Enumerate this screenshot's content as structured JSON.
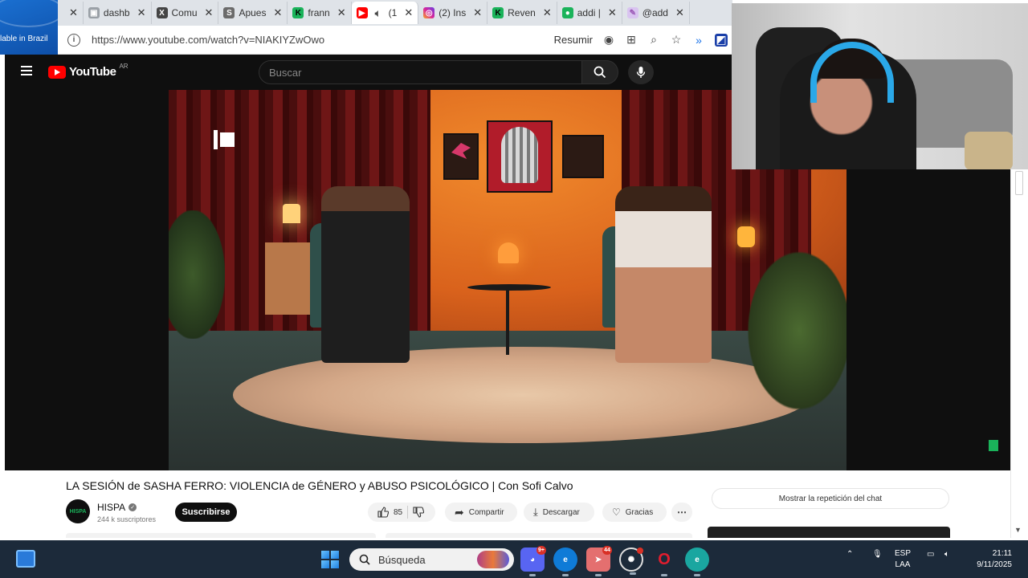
{
  "other_window": {
    "text": "lable in Brazil"
  },
  "browser": {
    "tabs": [
      {
        "label": "",
        "icon": "close-icon"
      },
      {
        "label": "dashb",
        "icon": "page-icon",
        "color": "#5f6368"
      },
      {
        "label": "Comu",
        "icon": "x-icon",
        "color": "#444444"
      },
      {
        "label": "Apues",
        "icon": "s-icon",
        "color": "#6b6b6b"
      },
      {
        "label": "frann",
        "icon": "kick-icon",
        "color": "#1ab35a"
      },
      {
        "label": "(1",
        "icon": "youtube-icon",
        "color": "#ff0000",
        "active": true
      },
      {
        "label": "(2) Ins",
        "icon": "instagram-icon",
        "color": "#d6249f"
      },
      {
        "label": "Reven",
        "icon": "kick-icon",
        "color": "#1ab35a"
      },
      {
        "label": "addi |",
        "icon": "pin-icon",
        "color": "#1ab35a"
      },
      {
        "label": "@add",
        "icon": "feather-icon",
        "color": "#9b59b6"
      }
    ],
    "url": "https://www.youtube.com/watch?v=NIAKIYZwOwo",
    "resumir_label": "Resumir"
  },
  "youtube": {
    "logo_text": "YouTube",
    "region": "AR",
    "search_placeholder": "Buscar"
  },
  "video": {
    "title": "LA SESIÓN de SASHA FERRO: VIOLENCIA de GÉNERO y ABUSO PSICOLÓGICO | Con Sofi Calvo",
    "channel": "HISPA",
    "avatar_text": "HISPA",
    "subscribers": "244 k suscriptores",
    "subscribe_label": "Suscribirse",
    "likes": "85",
    "share_label": "Compartir",
    "download_label": "Descargar",
    "thanks_label": "Gracias",
    "chat_replay_label": "Mostrar la repetición del chat"
  },
  "taskbar": {
    "search_label": "Búsqueda",
    "apps": [
      {
        "name": "discord",
        "badge": "9+",
        "color": "#5865f2"
      },
      {
        "name": "edge",
        "badge": "",
        "color": "#0f7bd7"
      },
      {
        "name": "telegram",
        "badge": "44",
        "color": "#2aa3e0"
      },
      {
        "name": "chatgpt",
        "badge": "",
        "color": "#444444"
      },
      {
        "name": "opera",
        "badge": "",
        "color": "#e11d2e"
      },
      {
        "name": "edge-dev",
        "badge": "",
        "color": "#1aa6a0"
      }
    ],
    "language": "ESP",
    "layout": "LAA",
    "time": "21:11",
    "date": "9/11/2025"
  }
}
